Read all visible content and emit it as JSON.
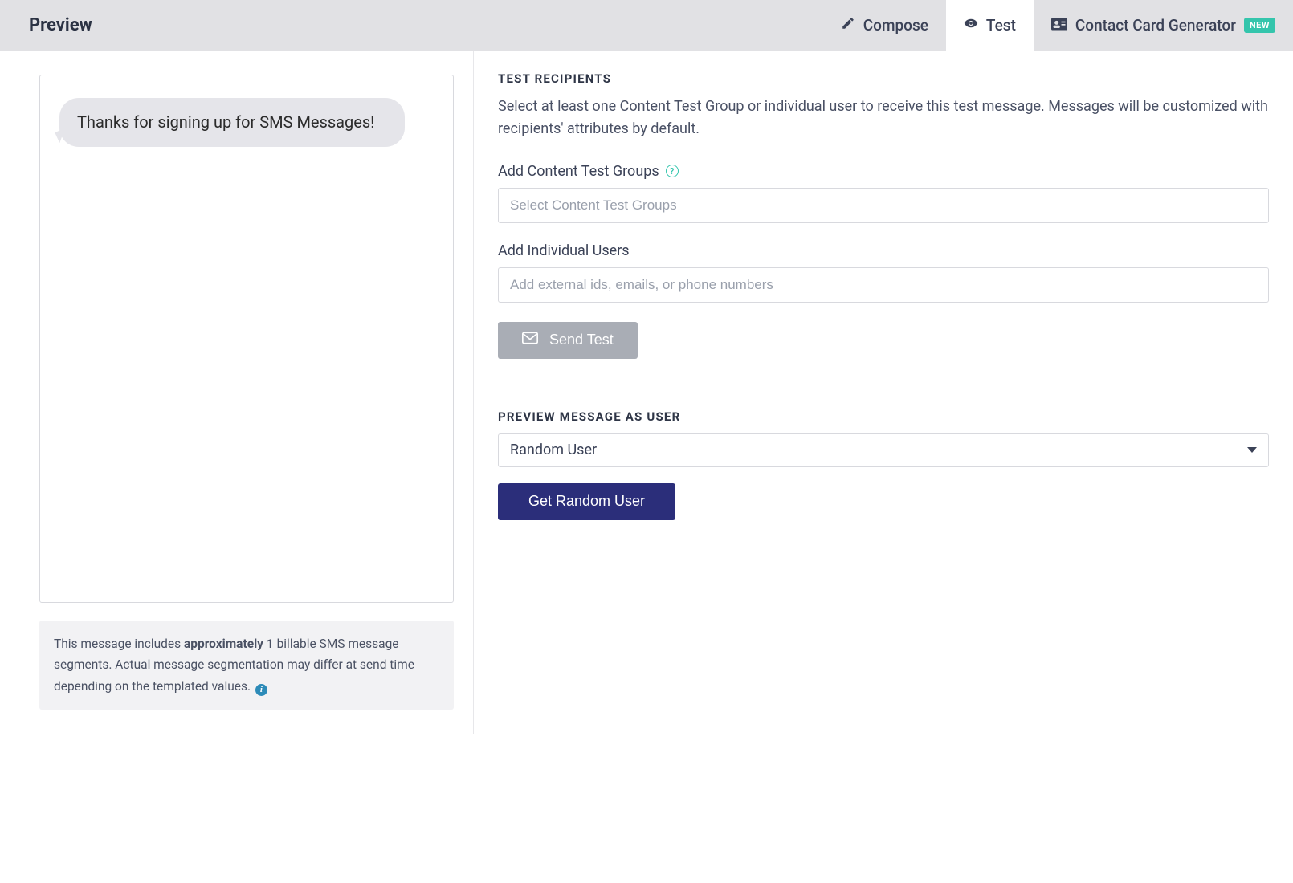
{
  "header": {
    "title": "Preview",
    "tabs": {
      "compose": "Compose",
      "test": "Test",
      "contact": "Contact Card Generator",
      "badge_new": "NEW"
    }
  },
  "preview": {
    "message": "Thanks for signing up for SMS Messages!",
    "info_pre": "This message includes ",
    "info_bold": "approximately 1",
    "info_post": " billable SMS message segments. Actual message segmentation may differ at send time depending on the templated values."
  },
  "test_panel": {
    "heading": "TEST RECIPIENTS",
    "description": "Select at least one Content Test Group or individual user to receive this test message. Messages will be customized with recipients' attributes by default.",
    "groups_label": "Add Content Test Groups",
    "groups_placeholder": "Select Content Test Groups",
    "users_label": "Add Individual Users",
    "users_placeholder": "Add external ids, emails, or phone numbers",
    "send_test_label": "Send Test"
  },
  "preview_as": {
    "heading": "PREVIEW MESSAGE AS USER",
    "selected": "Random User",
    "button": "Get Random User"
  }
}
